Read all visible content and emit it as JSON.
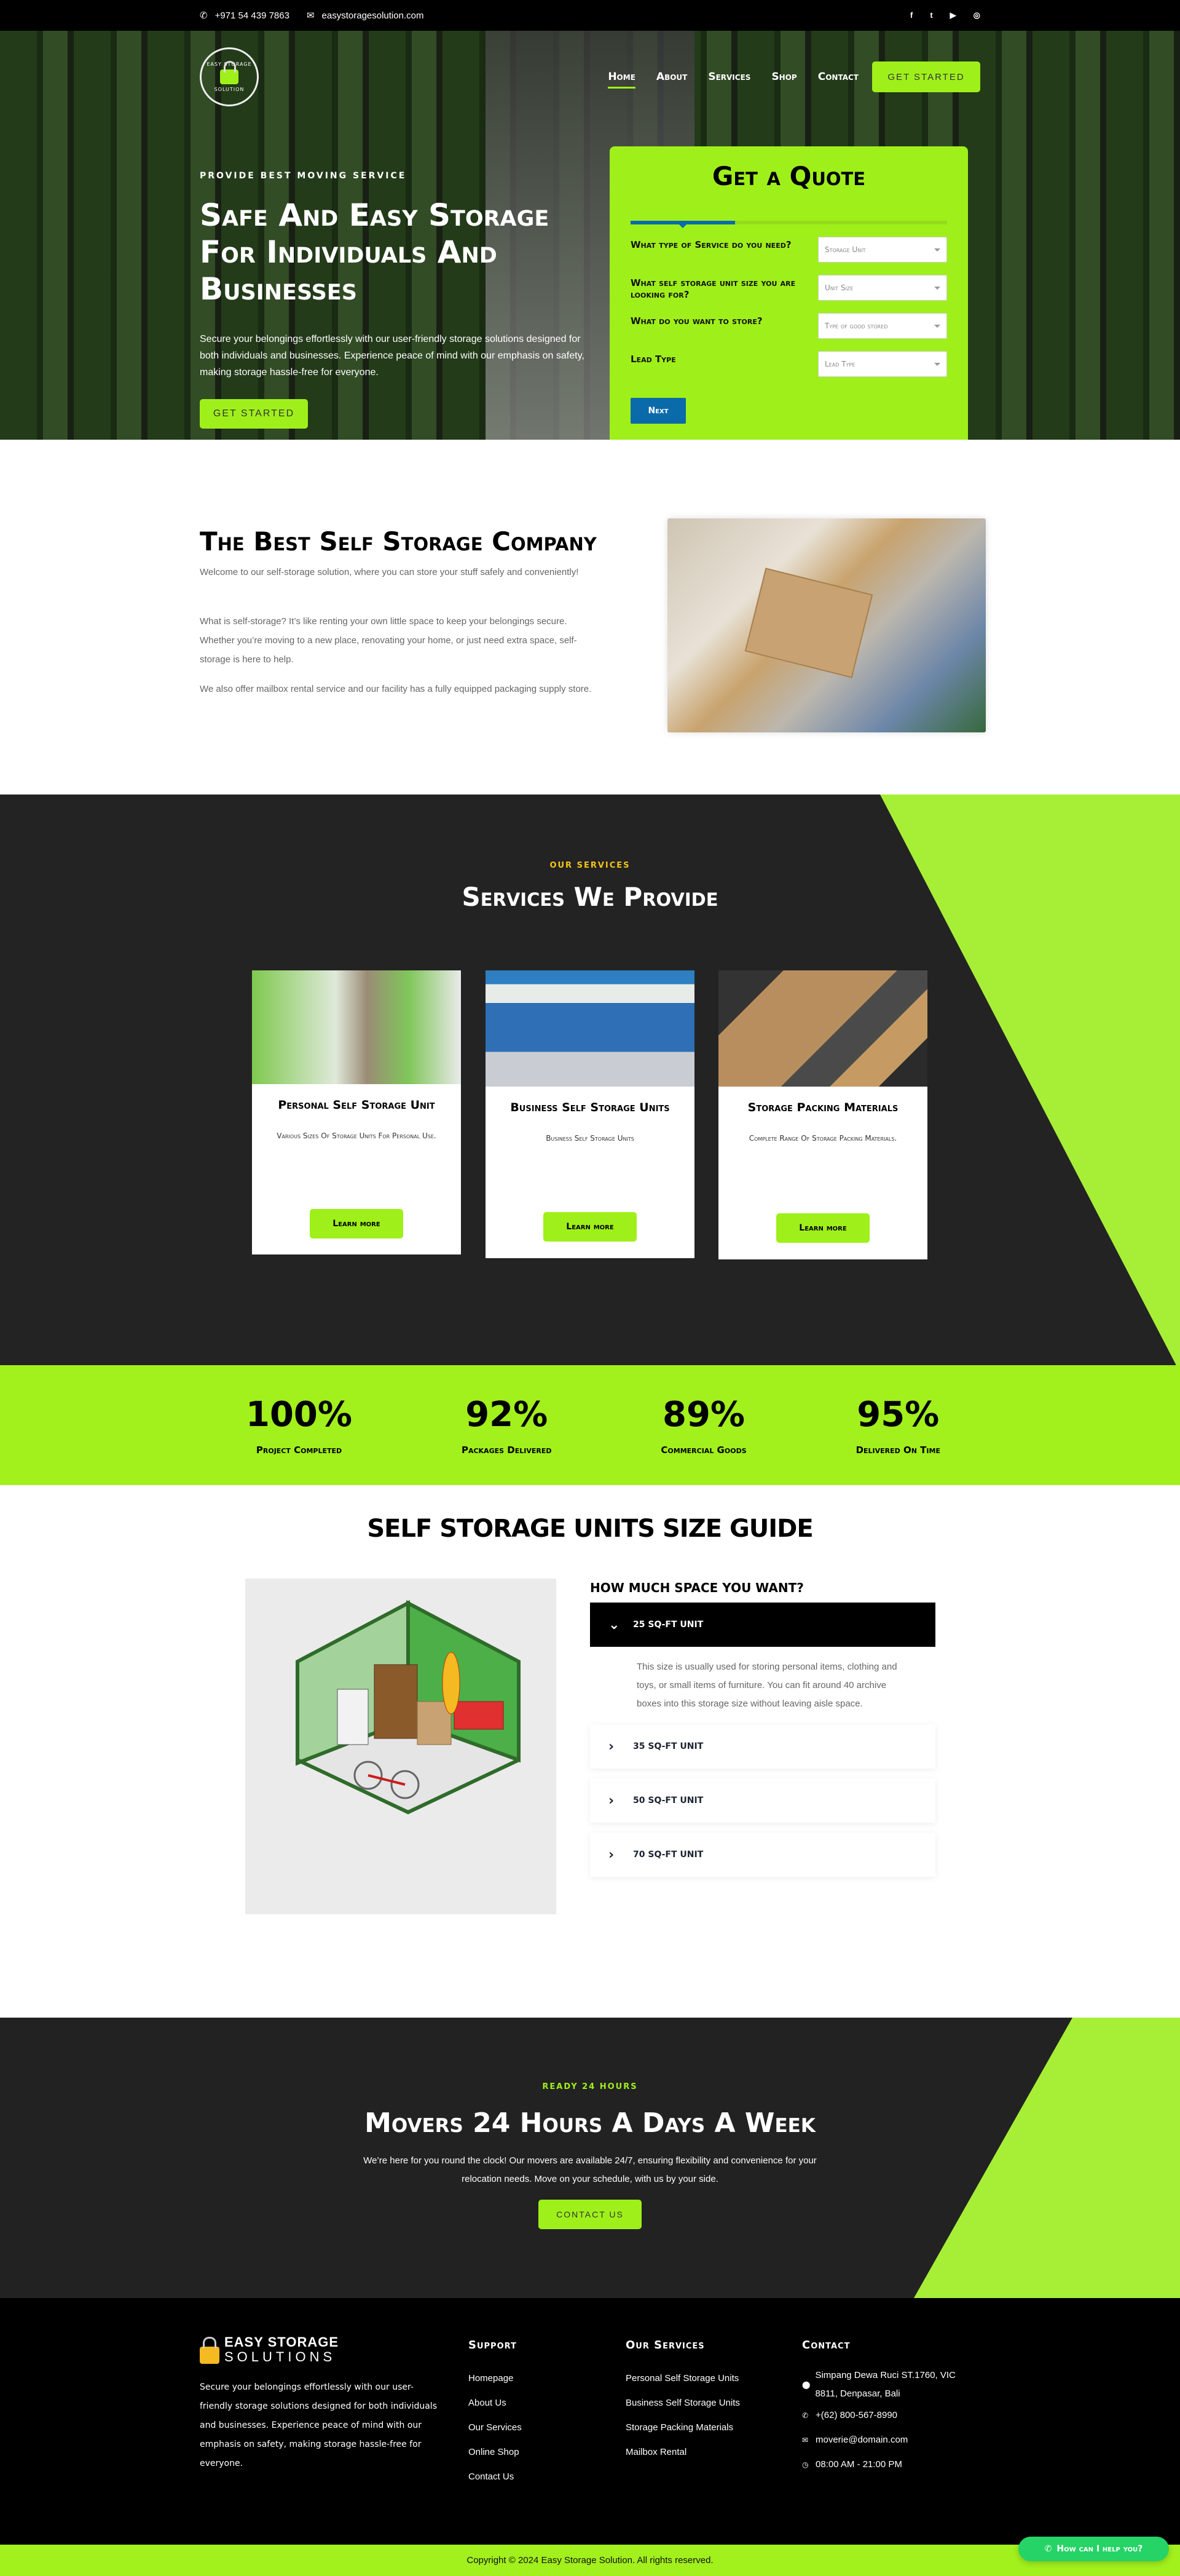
{
  "colors": {
    "accent": "#9ff01a",
    "quote_blue": "#0a6aaa",
    "dark": "#232323",
    "whatsapp": "#25d366",
    "eyebrow_yellow": "#f5c518"
  },
  "topbar": {
    "phone": "+971 54 439 7863",
    "email": "easystoragesolution.com",
    "social": [
      {
        "icon": "facebook-icon",
        "glyph": "f"
      },
      {
        "icon": "twitter-icon",
        "glyph": "t"
      },
      {
        "icon": "youtube-icon",
        "glyph": "▶"
      },
      {
        "icon": "instagram-icon",
        "glyph": "◎"
      }
    ]
  },
  "logo": {
    "top": "EASY STORAGE",
    "bottom": "SOLUTION"
  },
  "nav": {
    "items": [
      "Home",
      "About",
      "Services",
      "Shop",
      "Contact"
    ],
    "active": "Home",
    "cta": "GET STARTED"
  },
  "hero": {
    "eyebrow": "PROVIDE BEST MOVING SERVICE",
    "title": "Safe And Easy Storage For Individuals And Businesses",
    "description": "Secure your belongings effortlessly with our user-friendly storage solutions designed for both individuals and businesses. Experience peace of mind with our emphasis on safety, making storage hassle-free for everyone.",
    "cta": "GET STARTED"
  },
  "quote": {
    "title": "Get a Quote",
    "progress": 0.33,
    "fields": [
      {
        "label": "What type of Service do you need?",
        "placeholder": "Storage Unit"
      },
      {
        "label": "What self storage unit size you are looking for?",
        "placeholder": "Unit Size"
      },
      {
        "label": "What do you want to store?",
        "placeholder": "Type of good stored"
      },
      {
        "label": "Lead Type",
        "placeholder": "Lead Type"
      }
    ],
    "next": "Next"
  },
  "about": {
    "title": "The Best Self Storage Company",
    "paragraphs": [
      "Welcome to our self-storage solution, where you can store your stuff safely and conveniently!",
      "What is self-storage? It’s like renting your own little space to keep your belongings secure. Whether you’re moving to a new place, renovating your home, or just need extra space, self-storage is here to help.",
      "We also offer mailbox rental service and our facility has a fully equipped packaging supply store."
    ]
  },
  "services": {
    "eyebrow": "OUR SERVICES",
    "title": "Services We Provide",
    "cards": [
      {
        "title": "Personal Self Storage Unit",
        "description": "Various Sizes Of Storage Units For Personal Use.",
        "cta": "Learn more"
      },
      {
        "title": "Business Self Storage Units",
        "description": "Business Self Storage Units",
        "cta": "Learn more"
      },
      {
        "title": "Storage Packing Materials",
        "description": "Complete Range Of Storage Packing Materials.",
        "cta": "Learn more"
      }
    ]
  },
  "stats": [
    {
      "value": "100%",
      "label": "Project Completed"
    },
    {
      "value": "92%",
      "label": "Packages Delivered"
    },
    {
      "value": "89%",
      "label": "Commercial Goods"
    },
    {
      "value": "95%",
      "label": "Delivered On Time"
    }
  ],
  "guide": {
    "title": "SELF STORAGE UNITS SIZE GUIDE",
    "subtitle": "HOW MUCH SPACE YOU WANT?",
    "items": [
      {
        "label": "25 SQ-FT UNIT",
        "open": true,
        "body": "This size is usually used for storing personal items, clothing and toys, or small items of furniture. You can fit around 40 archive boxes into this storage size without leaving aisle space."
      },
      {
        "label": "35 SQ-FT UNIT",
        "open": false
      },
      {
        "label": "50 SQ-FT UNIT",
        "open": false
      },
      {
        "label": "70 SQ-FT UNIT",
        "open": false
      }
    ]
  },
  "movers": {
    "eyebrow": "READY 24 HOURS",
    "title": "Movers 24 Hours A Days A Week",
    "description": "We’re here for you round the clock! Our movers are available 24/7, ensuring flexibility and convenience for your relocation needs. Move on your schedule, with us by your side.",
    "cta": "CONTACT US"
  },
  "footer": {
    "logo_line1": "EASY STORAGE",
    "logo_line2": "SOLUTIONS",
    "description": "Secure your belongings effortlessly with our user-friendly storage solutions designed for both individuals and businesses. Experience peace of mind with our emphasis on safety, making storage hassle-free for everyone.",
    "support": {
      "title": "Support",
      "links": [
        "Homepage",
        "About Us",
        "Our Services",
        "Online Shop",
        "Contact Us"
      ]
    },
    "services": {
      "title": "Our Services",
      "links": [
        "Personal Self Storage Units",
        "Business Self Storage Units",
        "Storage Packing Materials",
        "Mailbox Rental"
      ]
    },
    "contact": {
      "title": "Contact",
      "address": "Simpang Dewa Ruci ST.1760, VIC 8811, Denpasar, Bali",
      "phone": "+(62) 800-567-8990",
      "email": "moverie@domain.com",
      "hours": "08:00 AM - 21:00 PM"
    },
    "copyright": "Copyright © 2024 Easy Storage Solution. All rights reserved."
  },
  "chat_widget": {
    "label": "How can I help you?"
  }
}
